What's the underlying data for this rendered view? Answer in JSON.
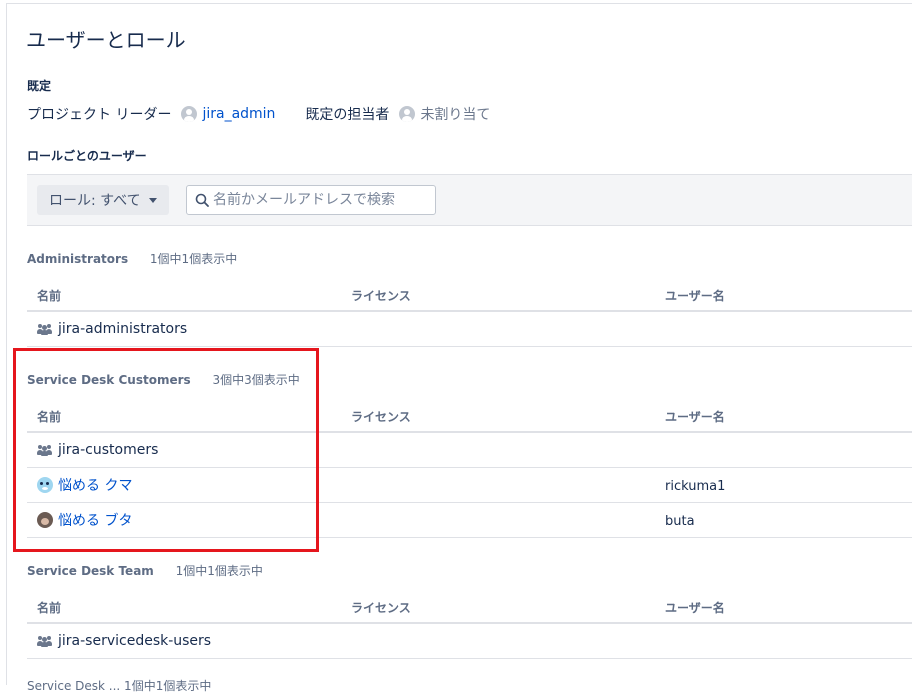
{
  "page": {
    "title": "ユーザーとロール"
  },
  "defaults": {
    "heading": "既定",
    "project_lead_label": "プロジェクト リーダー",
    "project_lead_user": "jira_admin",
    "default_assignee_label": "既定の担当者",
    "default_assignee_value": "未割り当て"
  },
  "users_by_role": {
    "heading": "ロールごとのユーザー",
    "role_filter_label": "ロール: すべて",
    "search_placeholder": "名前かメールアドレスで検索"
  },
  "columns": {
    "name": "名前",
    "license": "ライセンス",
    "username": "ユーザー名"
  },
  "roles": [
    {
      "name": "Administrators",
      "count": "1個中1個表示中",
      "rows": [
        {
          "type": "group",
          "name": "jira-administrators",
          "license": "",
          "username": ""
        }
      ]
    },
    {
      "name": "Service Desk Customers",
      "count": "3個中3個表示中",
      "rows": [
        {
          "type": "group",
          "name": "jira-customers",
          "license": "",
          "username": ""
        },
        {
          "type": "user",
          "name": "悩める クマ",
          "license": "",
          "username": "rickuma1"
        },
        {
          "type": "user",
          "name": "悩める ブタ",
          "license": "",
          "username": "buta"
        }
      ]
    },
    {
      "name": "Service Desk Team",
      "count": "1個中1個表示中",
      "rows": [
        {
          "type": "group",
          "name": "jira-servicedesk-users",
          "license": "",
          "username": ""
        }
      ]
    }
  ],
  "cut_off_text": "Service Desk ...     1個中1個表示中",
  "colors": {
    "link": "#0052cc",
    "highlight_border": "#e5161d",
    "toolbar_bg": "#f4f5f7"
  }
}
